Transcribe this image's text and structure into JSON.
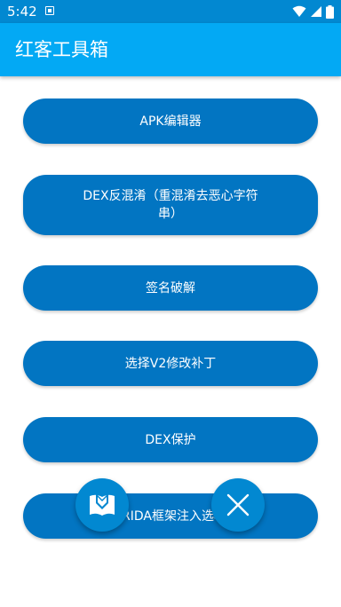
{
  "status_bar": {
    "time": "5:42",
    "icons": [
      "notification-icon",
      "wifi-icon",
      "signal-icon",
      "battery-icon"
    ]
  },
  "app_bar": {
    "title": "红客工具箱"
  },
  "menu": {
    "items": [
      {
        "label": "APK编辑器"
      },
      {
        "label": "DEX反混淆（重混淆去恶心字符串）"
      },
      {
        "label": "签名破解"
      },
      {
        "label": "选择V2修改补丁"
      },
      {
        "label": "DEX保护"
      },
      {
        "label": "FRIDA框架注入选项"
      }
    ]
  },
  "fabs": {
    "book_icon": "book-icon",
    "close_icon": "close-icon"
  },
  "colors": {
    "status_bar": "#0288d1",
    "app_bar": "#03a9f4",
    "button": "#0275c2",
    "fab": "#0288d1",
    "text_on_primary": "#ffffff"
  }
}
